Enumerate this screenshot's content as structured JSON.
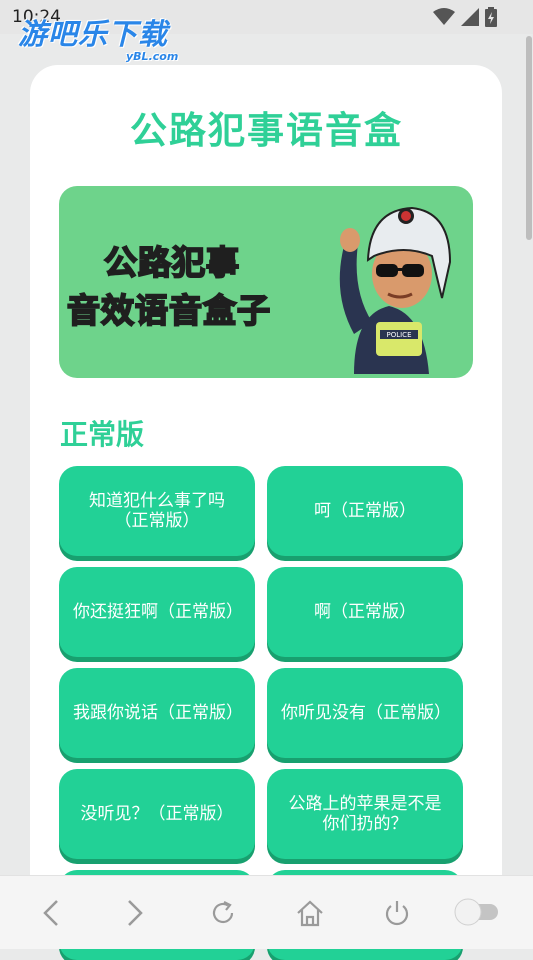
{
  "status_bar": {
    "time": "10:24"
  },
  "watermark": {
    "main": "游吧乐下载",
    "sub": "yBL.com"
  },
  "page": {
    "title": "公路犯事语音盒"
  },
  "banner": {
    "line1": "公路犯事",
    "line2": "音效语音盒子"
  },
  "section": {
    "title": "正常版"
  },
  "buttons": [
    {
      "label": "知道犯什么事了吗（正常版）"
    },
    {
      "label": "呵（正常版）"
    },
    {
      "label": "你还挺狂啊（正常版）"
    },
    {
      "label": "啊（正常版）"
    },
    {
      "label": "我跟你说话（正常版）"
    },
    {
      "label": "你听见没有（正常版）"
    },
    {
      "label": "没听见？（正常版）"
    },
    {
      "label": "公路上的苹果是不是你们扔的？"
    }
  ],
  "nav": {
    "icons": [
      "back-arrow-icon",
      "forward-arrow-icon",
      "refresh-icon",
      "home-icon",
      "power-icon",
      "toggle-switch-icon"
    ]
  },
  "colors": {
    "accent": "#22d196",
    "title": "#2fd097",
    "banner": "#6ed38b"
  }
}
